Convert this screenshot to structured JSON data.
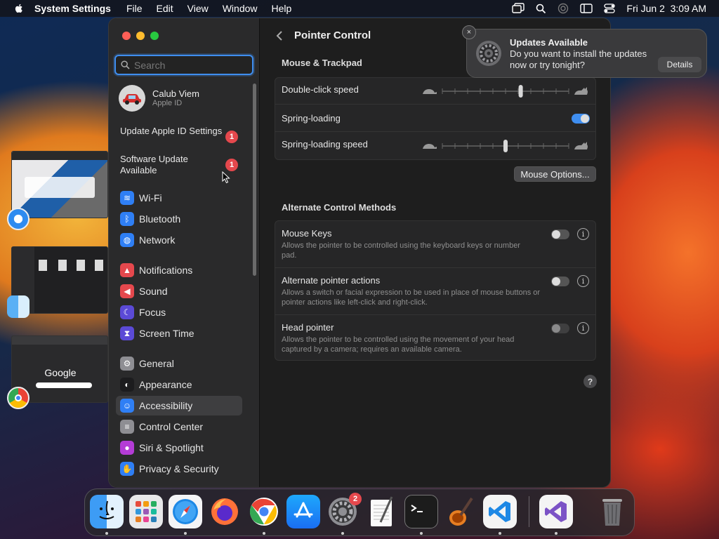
{
  "menubar": {
    "app_name": "System Settings",
    "menus": [
      "File",
      "Edit",
      "View",
      "Window",
      "Help"
    ],
    "datetime": "Fri Jun 2  3:09 AM"
  },
  "mission_control": {
    "thumb_google_text": "Google"
  },
  "sidebar": {
    "search_placeholder": "Search",
    "profile": {
      "name": "Calub Viem",
      "subtitle": "Apple ID"
    },
    "updates": [
      {
        "label": "Update Apple ID Settings",
        "badge": "1"
      },
      {
        "label": "Software Update Available",
        "badge": "1"
      }
    ],
    "items": [
      {
        "label": "Wi-Fi",
        "icon": "wifi-icon",
        "color": "#2f7ff5"
      },
      {
        "label": "Bluetooth",
        "icon": "bluetooth-icon",
        "color": "#2f7ff5"
      },
      {
        "label": "Network",
        "icon": "globe-icon",
        "color": "#2f7ff5"
      },
      {
        "label": "Notifications",
        "icon": "bell-icon",
        "color": "#e5484d"
      },
      {
        "label": "Sound",
        "icon": "speaker-icon",
        "color": "#e5484d"
      },
      {
        "label": "Focus",
        "icon": "moon-icon",
        "color": "#5b4ad6"
      },
      {
        "label": "Screen Time",
        "icon": "hourglass-icon",
        "color": "#5b4ad6"
      },
      {
        "label": "General",
        "icon": "gear-icon",
        "color": "#8e8e93"
      },
      {
        "label": "Appearance",
        "icon": "appearance-icon",
        "color": "#1c1c1e"
      },
      {
        "label": "Accessibility",
        "icon": "accessibility-icon",
        "color": "#2f7ff5"
      },
      {
        "label": "Control Center",
        "icon": "toggles-icon",
        "color": "#8e8e93"
      },
      {
        "label": "Siri & Spotlight",
        "icon": "siri-icon",
        "color": "#b43cd6"
      },
      {
        "label": "Privacy & Security",
        "icon": "hand-icon",
        "color": "#2f7ff5"
      }
    ],
    "selected": "Accessibility"
  },
  "main": {
    "title": "Pointer Control",
    "section1": {
      "heading": "Mouse & Trackpad",
      "double_click_label": "Double-click speed",
      "double_click_level": 0.62,
      "spring_loading_label": "Spring-loading",
      "spring_loading_on": true,
      "spring_speed_label": "Spring-loading speed",
      "spring_speed_level": 0.5,
      "mouse_options_label": "Mouse Options..."
    },
    "section2": {
      "heading": "Alternate Control Methods",
      "rows": [
        {
          "label": "Mouse Keys",
          "desc": "Allows the pointer to be controlled using the keyboard keys or number pad.",
          "on": false
        },
        {
          "label": "Alternate pointer actions",
          "desc": "Allows a switch or facial expression to be used in place of mouse buttons or pointer actions like left-click and right-click.",
          "on": false
        },
        {
          "label": "Head pointer",
          "desc": "Allows the pointer to be controlled using the movement of your head captured by a camera; requires an available camera.",
          "on": false
        }
      ]
    },
    "help_label": "?"
  },
  "notification": {
    "title": "Updates Available",
    "text": "Do you want to install the updates now or try tonight?",
    "button": "Details",
    "close": "×"
  },
  "dock": {
    "settings_badge": "2"
  },
  "colors": {
    "accent": "#3f8ef0",
    "badge": "#e5484d"
  }
}
